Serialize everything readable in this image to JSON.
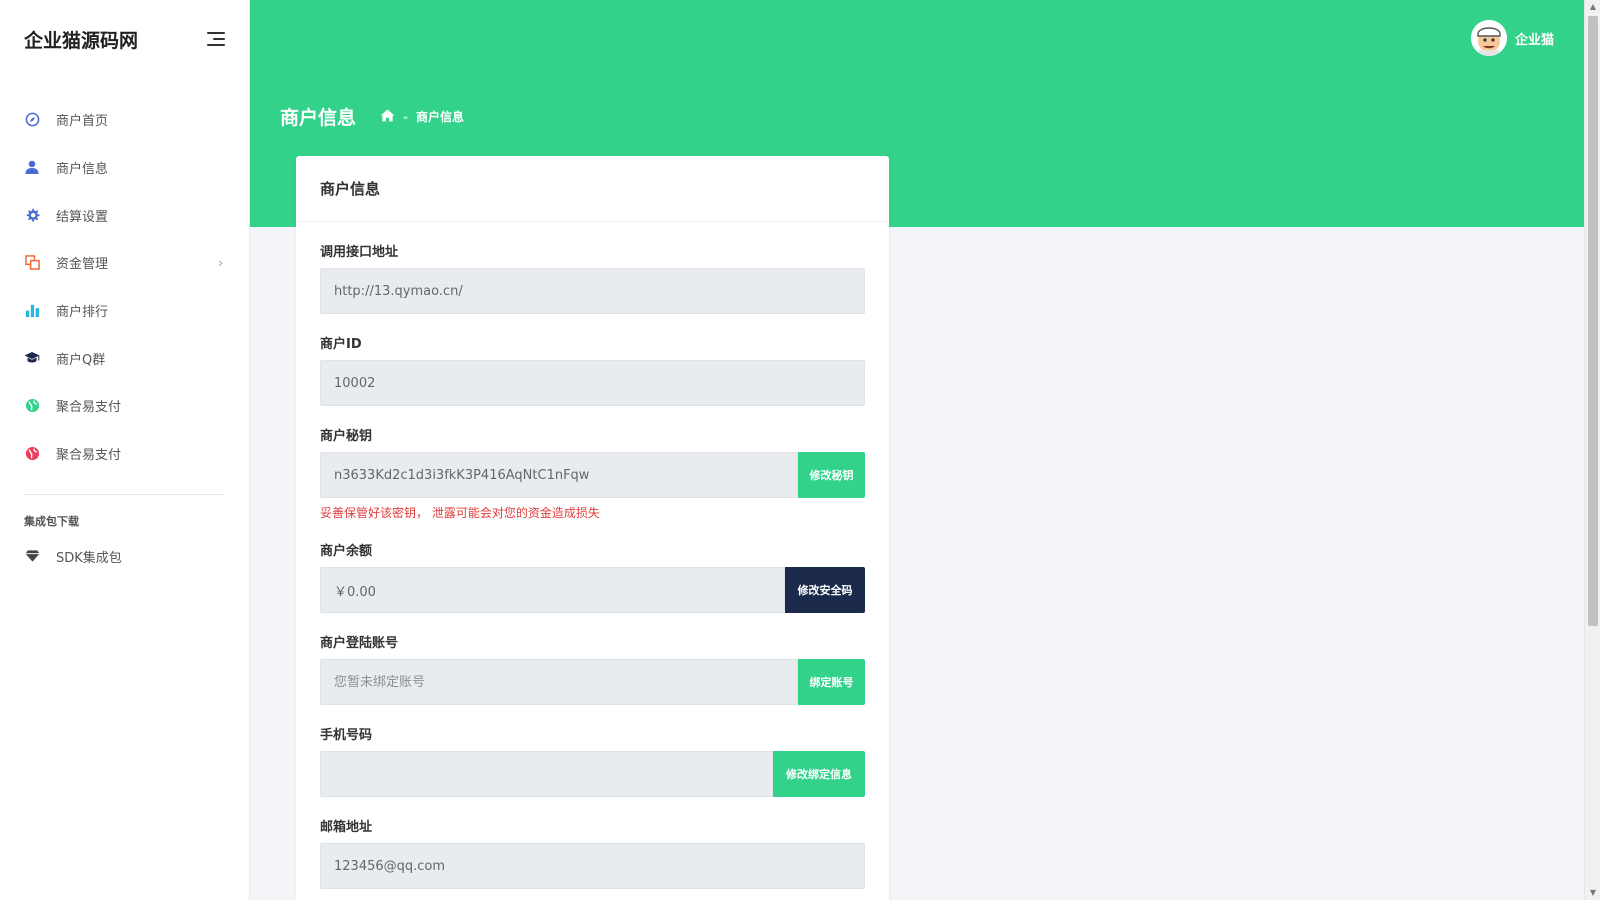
{
  "brand": {
    "name": "企业猫源码网"
  },
  "user": {
    "name": "企业猫"
  },
  "nav": {
    "items": [
      {
        "label": "商户首页",
        "icon": "compass-icon",
        "color": "#4a6cd4"
      },
      {
        "label": "商户信息",
        "icon": "user-icon",
        "color": "#4a6cd4"
      },
      {
        "label": "结算设置",
        "icon": "gear-icon",
        "color": "#4a6cd4"
      },
      {
        "label": "资金管理",
        "icon": "copy-icon",
        "color": "#f06a3b"
      },
      {
        "label": "商户排行",
        "icon": "bar-chart-icon",
        "color": "#27b6e0"
      },
      {
        "label": "商户Q群",
        "icon": "graduation-cap-icon",
        "color": "#1b2a4a"
      },
      {
        "label": "聚合易支付",
        "icon": "globe-icon",
        "color": "#32d28b"
      },
      {
        "label": "聚合易支付",
        "icon": "globe-icon",
        "color": "#ef3b5c"
      }
    ],
    "section_heading": "集成包下载",
    "sdk_item": {
      "label": "SDK集成包",
      "icon": "diamond-icon"
    }
  },
  "page": {
    "title": "商户信息",
    "breadcrumb": [
      "商户信息"
    ]
  },
  "card": {
    "title": "商户信息",
    "fields": {
      "api_url": {
        "label": "调用接口地址",
        "value": "http://13.qymao.cn/"
      },
      "merchant_id": {
        "label": "商户ID",
        "value": "10002"
      },
      "secret": {
        "label": "商户秘钥",
        "value": "n3633Kd2c1d3i3fkK3P416AqNtC1nFqw",
        "button": "修改秘钥",
        "warning": "妥善保管好该密钥， 泄露可能会对您的资金造成损失"
      },
      "balance": {
        "label": "商户余额",
        "value": "￥0.00",
        "button": "修改安全码"
      },
      "login_account": {
        "label": "商户登陆账号",
        "placeholder": "您暂未绑定账号",
        "button": "绑定账号"
      },
      "phone": {
        "label": "手机号码",
        "value": "",
        "button": "修改绑定信息"
      },
      "email": {
        "label": "邮箱地址",
        "value": "123456@qq.com"
      }
    }
  },
  "colors": {
    "accent": "#32d28b",
    "dark_button": "#1b2a4a",
    "warning": "#e23c3c"
  }
}
